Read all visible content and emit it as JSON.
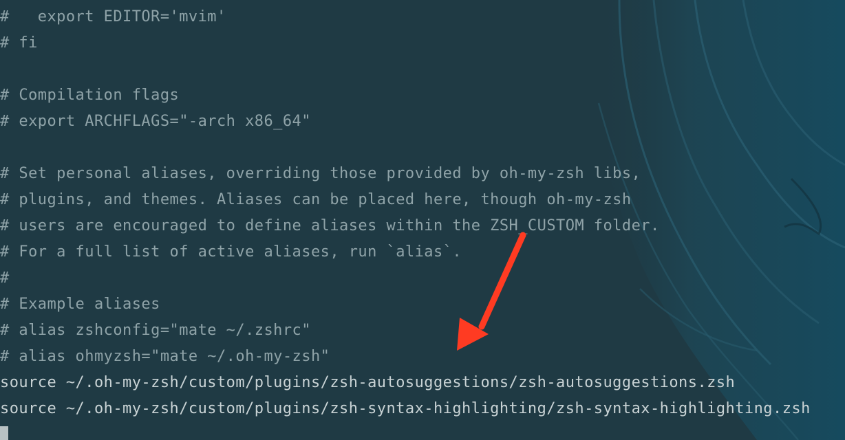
{
  "terminal": {
    "lines": [
      {
        "text": "#   export EDITOR='mvim'",
        "kind": "comment"
      },
      {
        "text": "# fi",
        "kind": "comment"
      },
      {
        "text": "",
        "kind": "blank"
      },
      {
        "text": "# Compilation flags",
        "kind": "comment"
      },
      {
        "text": "# export ARCHFLAGS=\"-arch x86_64\"",
        "kind": "comment"
      },
      {
        "text": "",
        "kind": "blank"
      },
      {
        "text": "# Set personal aliases, overriding those provided by oh-my-zsh libs,",
        "kind": "comment"
      },
      {
        "text": "# plugins, and themes. Aliases can be placed here, though oh-my-zsh",
        "kind": "comment"
      },
      {
        "text": "# users are encouraged to define aliases within the ZSH_CUSTOM folder.",
        "kind": "comment"
      },
      {
        "text": "# For a full list of active aliases, run `alias`.",
        "kind": "comment"
      },
      {
        "text": "#",
        "kind": "comment"
      },
      {
        "text": "# Example aliases",
        "kind": "comment"
      },
      {
        "text": "# alias zshconfig=\"mate ~/.zshrc\"",
        "kind": "comment"
      },
      {
        "text": "# alias ohmyzsh=\"mate ~/.oh-my-zsh\"",
        "kind": "comment"
      },
      {
        "text": "source ~/.oh-my-zsh/custom/plugins/zsh-autosuggestions/zsh-autosuggestions.zsh",
        "kind": "code"
      },
      {
        "text": "source ~/.oh-my-zsh/custom/plugins/zsh-syntax-highlighting/zsh-syntax-highlighting.zsh",
        "kind": "code"
      }
    ]
  },
  "colors": {
    "background": "#1f3a44",
    "comment": "#8fa3a8",
    "code": "#c8d2d4",
    "annotation_arrow": "#ff3b22"
  },
  "annotation": {
    "icon": "red-arrow-icon"
  }
}
